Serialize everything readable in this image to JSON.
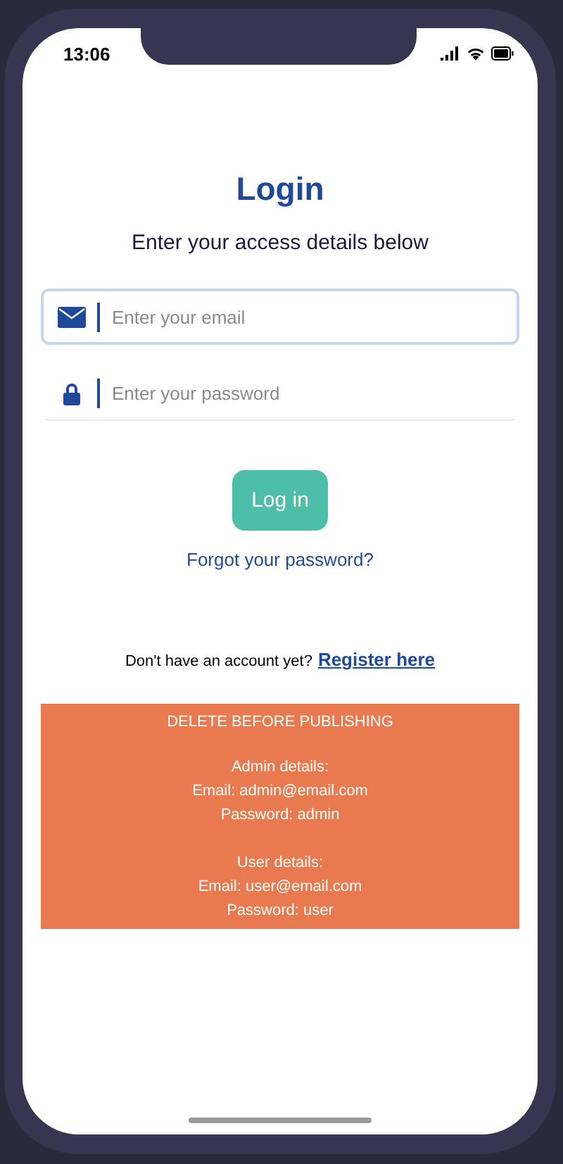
{
  "status_bar": {
    "time": "13:06"
  },
  "title": "Login",
  "subtitle": "Enter your access details below",
  "fields": [
    {
      "kind": "email",
      "placeholder": "Enter your email",
      "focused": true
    },
    {
      "kind": "password",
      "placeholder": "Enter your password",
      "focused": false
    }
  ],
  "login_button": "Log in",
  "forgot_link": "Forgot your password?",
  "register": {
    "prompt": "Don't have an account yet?",
    "link": "Register here"
  },
  "notice": {
    "heading": "DELETE BEFORE PUBLISHING",
    "groups": [
      [
        "Admin details:",
        "Email: admin@email.com",
        "Password: admin"
      ],
      [
        "User details:",
        "Email: user@email.com",
        "Password: user"
      ]
    ]
  }
}
